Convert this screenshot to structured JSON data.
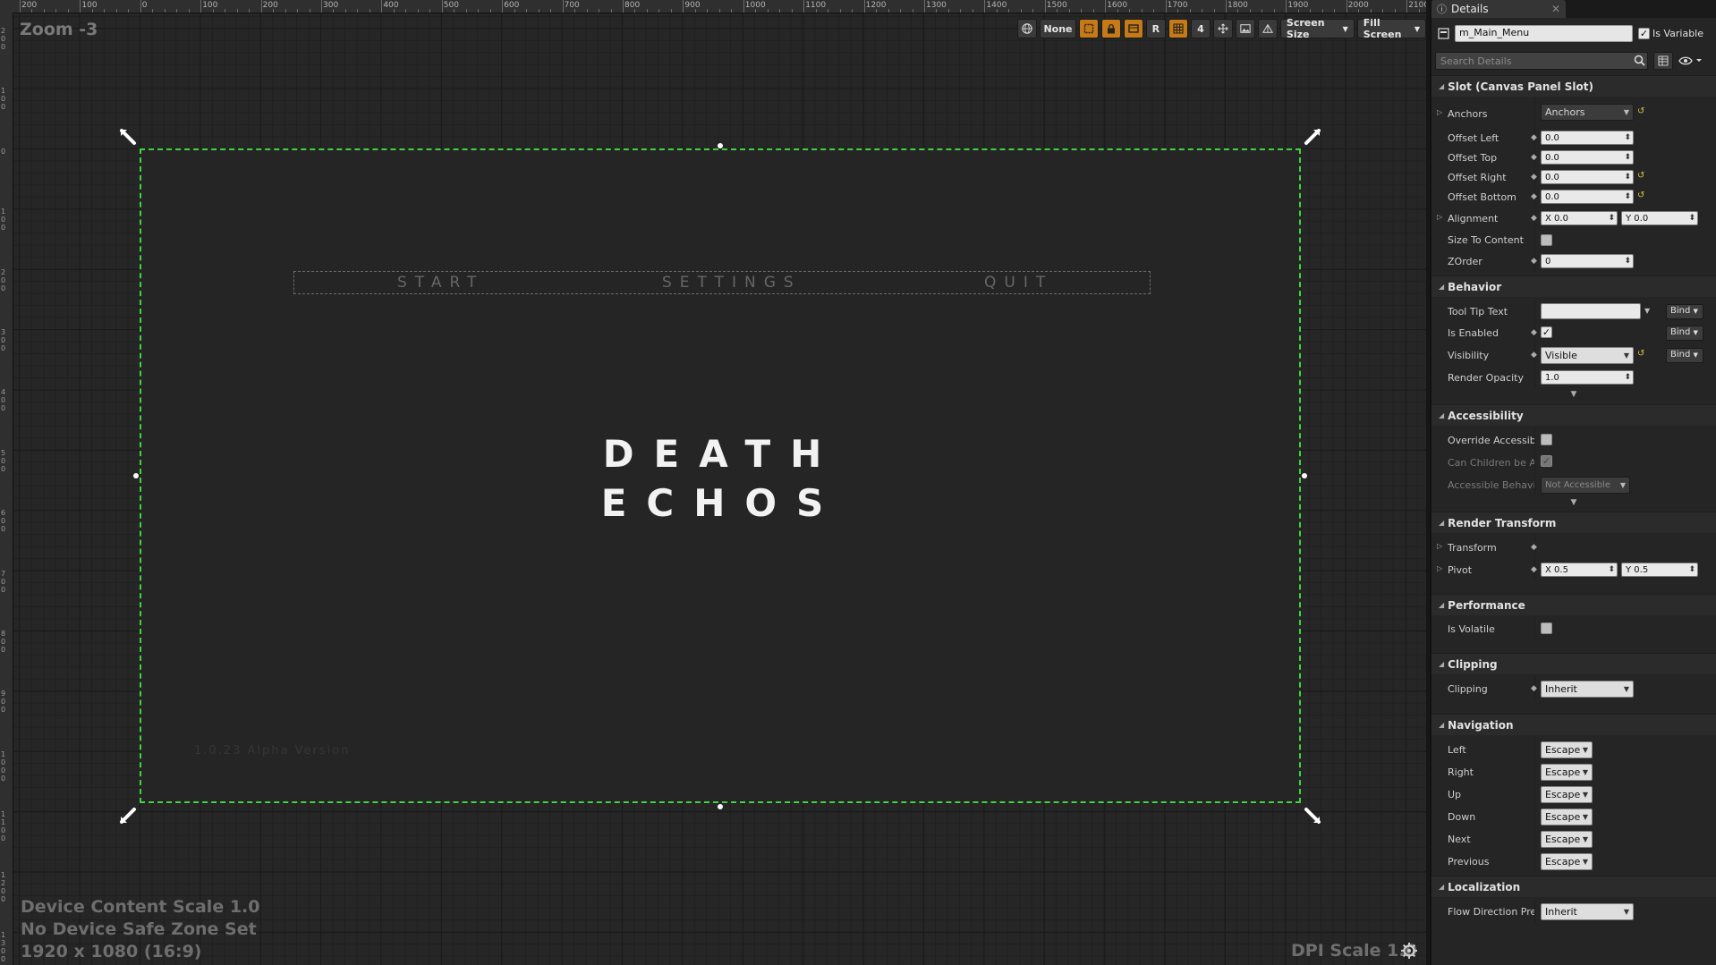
{
  "designer": {
    "zoom_label": "Zoom -3",
    "ruler_labels": [
      "200",
      "100",
      "0",
      "100",
      "200",
      "300",
      "400",
      "500",
      "600",
      "700",
      "800",
      "900",
      "1000",
      "1100",
      "1200",
      "1300",
      "1400",
      "1500",
      "1600",
      "1700",
      "1800",
      "1900",
      "2000",
      "2100"
    ],
    "left_ruler_labels": [
      "200",
      "100",
      "0",
      "100",
      "200",
      "300",
      "400",
      "500",
      "600",
      "700",
      "800",
      "900",
      "1000",
      "1100",
      "1200",
      "1300"
    ],
    "toolbar": {
      "none_label": "None",
      "r_label": "R",
      "grid_count": "4",
      "screen_size_label": "Screen Size",
      "fill_screen_label": "Fill Screen"
    },
    "canvas": {
      "menu_buttons": [
        "START",
        "SETTINGS",
        "QUIT"
      ],
      "title_line1": "DEATH",
      "title_line2": "ECHOS",
      "version_text": "1.0.23 Alpha Version"
    },
    "overlay": {
      "device_scale": "Device Content Scale 1.0",
      "safe_zone": "No Device Safe Zone Set",
      "resolution": "1920 x 1080 (16:9)",
      "dpi_scale": "DPI Scale 1.0"
    }
  },
  "details": {
    "tab_label": "Details",
    "widget_name": "m_Main_Menu",
    "is_variable_label": "Is Variable",
    "is_variable_checked": true,
    "search_placeholder": "Search Details",
    "sections": {
      "slot": "Slot (Canvas Panel Slot)",
      "behavior": "Behavior",
      "accessibility": "Accessibility",
      "render_transform": "Render Transform",
      "performance": "Performance",
      "clipping": "Clipping",
      "navigation": "Navigation",
      "localization": "Localization"
    },
    "slot": {
      "anchors_label": "Anchors",
      "anchors_value": "Anchors",
      "offset_left_label": "Offset Left",
      "offset_left": "0.0",
      "offset_top_label": "Offset Top",
      "offset_top": "0.0",
      "offset_right_label": "Offset Right",
      "offset_right": "0.0",
      "offset_bottom_label": "Offset Bottom",
      "offset_bottom": "0.0",
      "alignment_label": "Alignment",
      "alignment_x": "X 0.0",
      "alignment_y": "Y 0.0",
      "size_to_content_label": "Size To Content",
      "zorder_label": "ZOrder",
      "zorder": "0"
    },
    "behavior": {
      "tooltip_label": "Tool Tip Text",
      "tooltip_value": "",
      "is_enabled_label": "Is Enabled",
      "visibility_label": "Visibility",
      "visibility_value": "Visible",
      "render_opacity_label": "Render Opacity",
      "render_opacity": "1.0",
      "bind_label": "Bind"
    },
    "accessibility": {
      "override_label": "Override Accessible",
      "children_label": "Can Children be Accessible",
      "behavior_label": "Accessible Behavior",
      "behavior_value": "Not Accessible"
    },
    "render_transform": {
      "transform_label": "Transform",
      "pivot_label": "Pivot",
      "pivot_x": "X 0.5",
      "pivot_y": "Y 0.5"
    },
    "performance": {
      "is_volatile_label": "Is Volatile"
    },
    "clipping": {
      "clipping_label": "Clipping",
      "clipping_value": "Inherit"
    },
    "navigation": {
      "rows": [
        {
          "label": "Left",
          "value": "Escape"
        },
        {
          "label": "Right",
          "value": "Escape"
        },
        {
          "label": "Up",
          "value": "Escape"
        },
        {
          "label": "Down",
          "value": "Escape"
        },
        {
          "label": "Next",
          "value": "Escape"
        },
        {
          "label": "Previous",
          "value": "Escape"
        }
      ]
    },
    "localization": {
      "flow_label": "Flow Direction Preference",
      "flow_value": "Inherit"
    }
  }
}
